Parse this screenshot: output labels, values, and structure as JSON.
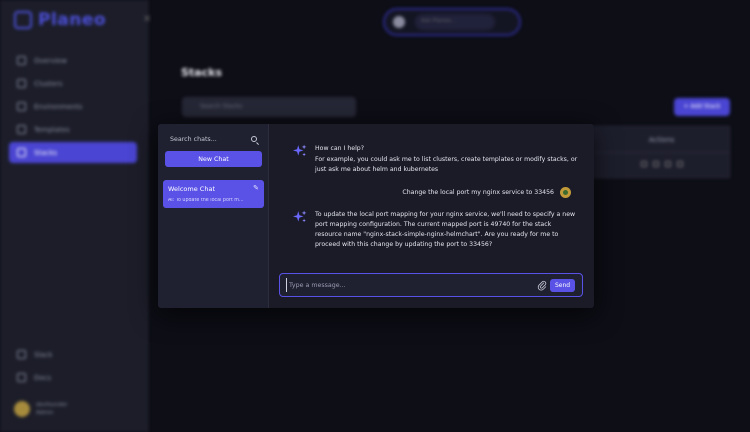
{
  "app": {
    "name": "Planeo"
  },
  "sidebar": {
    "items": [
      {
        "label": "Overview"
      },
      {
        "label": "Clusters"
      },
      {
        "label": "Environments"
      },
      {
        "label": "Templates"
      },
      {
        "label": "Stacks"
      }
    ],
    "bottom_items": [
      {
        "label": "Slack"
      },
      {
        "label": "Docs"
      }
    ],
    "user": {
      "name": "devfounder",
      "role": "Admin"
    }
  },
  "topbar": {
    "search_placeholder": "Ask Planeo..."
  },
  "page": {
    "title": "Stacks",
    "search_placeholder": "Search Stacks",
    "add_button": "+ Add Stack",
    "table_header_actions": "Actions"
  },
  "chat": {
    "search_placeholder": "Search chats...",
    "new_chat_label": "New Chat",
    "conversations": [
      {
        "title": "Welcome Chat",
        "preview": "AI: To update the local port m..."
      }
    ],
    "messages": [
      {
        "role": "assistant",
        "lines": [
          "How can I help?"
        ]
      },
      {
        "role": "assistant",
        "lines": [
          "For example, you could ask me to list clusters, create templates or modify stacks, or",
          "just ask me about helm and kubernetes"
        ]
      },
      {
        "role": "user",
        "text": "Change the local port my nginx service to 33456"
      },
      {
        "role": "assistant",
        "lines": [
          "To update the local port mapping for your nginx service, we'll need to specify a new",
          "port mapping configuration. The current mapped port is 49740 for the stack",
          "resource name \"nginx-stack-simple-nginx-helmchart\". Are you ready for me to",
          "proceed with this change by updating the port to 33456?"
        ]
      }
    ],
    "input_placeholder": "Type a message...",
    "send_label": "Send"
  },
  "colors": {
    "accent": "#5a52e6",
    "sidebar_active": "#4a45d2",
    "background": "#0d0e16"
  }
}
